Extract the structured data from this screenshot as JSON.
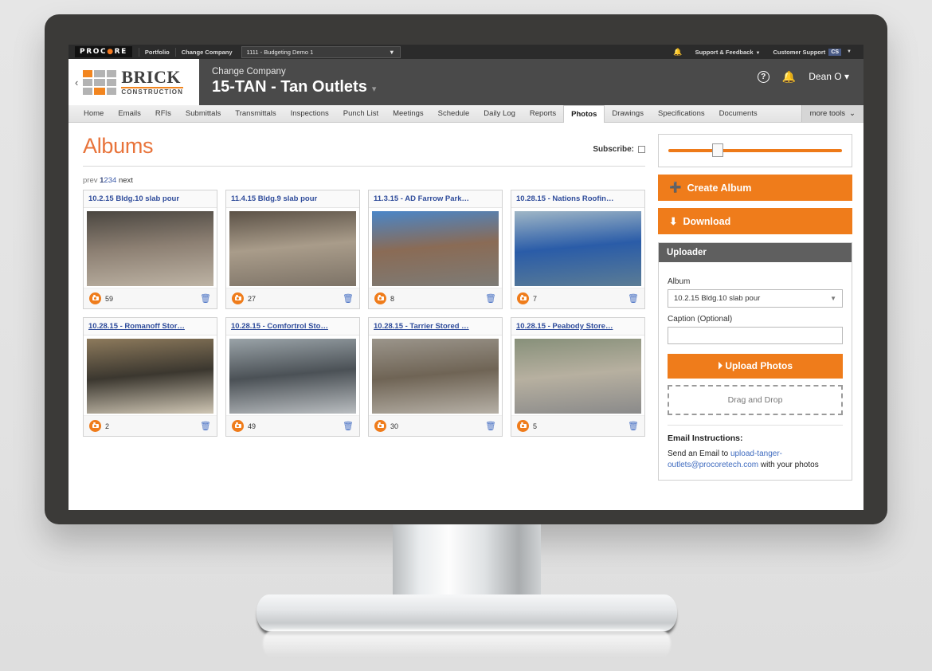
{
  "procore_bar": {
    "logo": "PROCORE",
    "items": [
      "Portfolio",
      "Change Company"
    ],
    "company_select": "1111 - Budgeting Demo 1",
    "bell_icon": "bell-icon",
    "support_feedback": "Support & Feedback",
    "customer_support": "Customer Support",
    "cs_badge": "CS"
  },
  "project_header": {
    "back_icon": "chevron-left-icon",
    "logo_word": "BRICK",
    "logo_sub": "CONSTRUCTION",
    "subtitle": "Change Company",
    "title": "15-TAN - Tan Outlets",
    "title_caret": "▾",
    "help_icon": "question-circle-icon",
    "bell_icon": "bell-icon",
    "user": "Dean O",
    "user_caret": "▾"
  },
  "tabs": {
    "items": [
      {
        "label": "Home",
        "active": false
      },
      {
        "label": "Emails",
        "active": false
      },
      {
        "label": "RFIs",
        "active": false
      },
      {
        "label": "Submittals",
        "active": false
      },
      {
        "label": "Transmittals",
        "active": false
      },
      {
        "label": "Inspections",
        "active": false
      },
      {
        "label": "Punch List",
        "active": false
      },
      {
        "label": "Meetings",
        "active": false
      },
      {
        "label": "Schedule",
        "active": false
      },
      {
        "label": "Daily Log",
        "active": false
      },
      {
        "label": "Reports",
        "active": false
      },
      {
        "label": "Photos",
        "active": true
      },
      {
        "label": "Drawings",
        "active": false
      },
      {
        "label": "Specifications",
        "active": false
      },
      {
        "label": "Documents",
        "active": false
      }
    ],
    "more_tools": "more tools",
    "more_tools_caret": "⌄"
  },
  "main": {
    "page_title": "Albums",
    "subscribe_label": "Subscribe:",
    "pagination": {
      "prev": "prev",
      "pages": [
        "1",
        "2",
        "3",
        "4"
      ],
      "current": "1",
      "next": "next"
    },
    "albums": [
      {
        "title": "10.2.15 Bldg.10 slab pour",
        "count": "59",
        "underline": false,
        "thumb": {
          "top": "#4a4640",
          "mid": "#8d8073",
          "bottom": "#bdb3a4"
        }
      },
      {
        "title": "11.4.15 Bldg.9 slab pour",
        "count": "27",
        "underline": false,
        "thumb": {
          "top": "#5c5247",
          "mid": "#a99c8a",
          "bottom": "#7d7367"
        }
      },
      {
        "title": "11.3.15 - AD Farrow Park…",
        "count": "8",
        "underline": false,
        "thumb": {
          "top": "#4a86c8",
          "mid": "#8a6b55",
          "bottom": "#7d7b76"
        }
      },
      {
        "title": "10.28.15 - Nations Roofin…",
        "count": "7",
        "underline": false,
        "thumb": {
          "top": "#9fb6c6",
          "mid": "#2a5ca8",
          "bottom": "#5b7c95"
        }
      },
      {
        "title": "10.28.15 - Romanoff Stor…",
        "count": "2",
        "underline": true,
        "thumb": {
          "top": "#8d7a5c",
          "mid": "#3b372f",
          "bottom": "#cfc6b4"
        }
      },
      {
        "title": "10.28.15 - Comfortrol Sto…",
        "count": "49",
        "underline": true,
        "thumb": {
          "top": "#9aa3a8",
          "mid": "#4b5156",
          "bottom": "#b9bdc0"
        }
      },
      {
        "title": "10.28.15 - Tarrier Stored …",
        "count": "30",
        "underline": true,
        "thumb": {
          "top": "#9b958b",
          "mid": "#6f6455",
          "bottom": "#b6b0a6"
        }
      },
      {
        "title": "10.28.15 - Peabody Store…",
        "count": "5",
        "underline": true,
        "thumb": {
          "top": "#87907a",
          "mid": "#b7b0a0",
          "bottom": "#8a8a8a"
        }
      }
    ],
    "trash_icon": "trash-icon",
    "camera_icon": "camera-icon"
  },
  "sidebar": {
    "slider": {
      "name": "thumbnail-size-slider",
      "value_percent": 25
    },
    "create_album": {
      "label": "Create Album",
      "icon": "plus-icon"
    },
    "download": {
      "label": "Download",
      "icon": "download-icon"
    },
    "uploader": {
      "heading": "Uploader",
      "album_label": "Album",
      "album_value": "10.2.15 Bldg.10 slab pour",
      "caption_label": "Caption (Optional)",
      "caption_value": "",
      "upload_button": "Upload Photos",
      "upload_icon": "upload-circle-icon",
      "drag_drop": "Drag and Drop",
      "email_heading": "Email Instructions:",
      "email_text_before": "Send an Email to ",
      "email_address": "upload-tanger-outlets@procoretech.com",
      "email_text_after": " with your photos"
    }
  },
  "colors": {
    "accent_orange": "#ef7c1b",
    "title_orange": "#e8733a",
    "link_blue": "#2f4c9b",
    "header_gray": "#4a4a4a",
    "topbar_dark": "#2b2b2b"
  }
}
